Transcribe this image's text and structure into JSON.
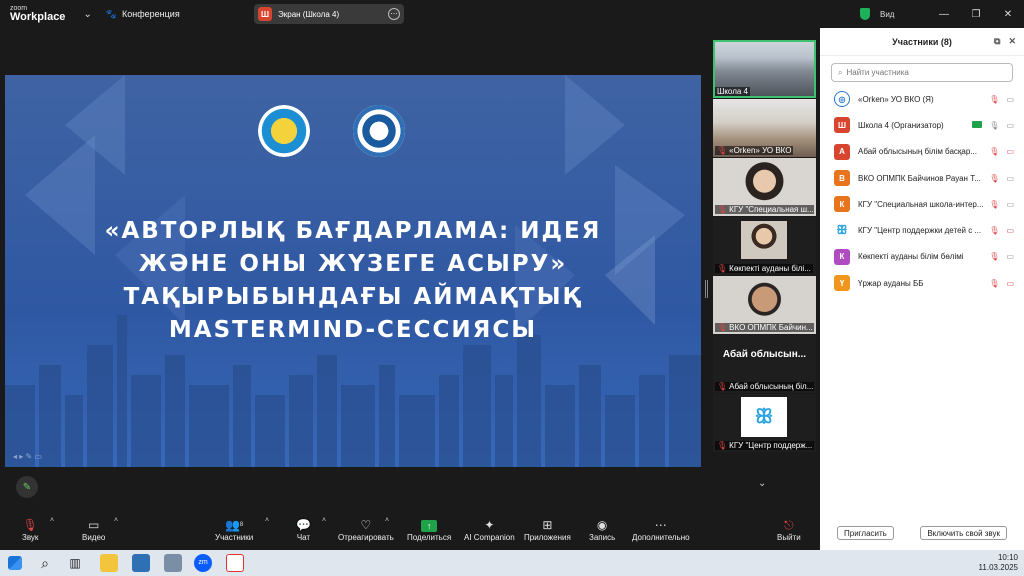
{
  "app": {
    "logo_line1": "zoom",
    "logo_line2": "Workplace",
    "meeting_label": "Конференция"
  },
  "share_pill": {
    "badge": "Ш",
    "label": "Экран (Школа 4)"
  },
  "view_label": "Вид",
  "slide": {
    "title_lines": [
      "«АВТОРЛЫҚ БАҒДАРЛАМА: ИДЕЯ",
      "ЖӘНЕ ОНЫ ЖҮЗЕГЕ АСЫРУ»",
      "ТАҚЫРЫБЫНДАҒЫ АЙМАҚТЫҚ",
      "MASTERMIND-СЕССИЯСЫ"
    ],
    "bg_color": "#3460aa"
  },
  "thumbnails": [
    {
      "name": "Школа 4",
      "muted": false,
      "active": true
    },
    {
      "name": "«Orken» УО ВКО",
      "muted": true
    },
    {
      "name": "КГУ \"Специальная ш...",
      "muted": true
    },
    {
      "name": "Көкпекті ауданы білі...",
      "muted": true
    },
    {
      "name": "ВКО ОПМПК Байчин...",
      "muted": true
    },
    {
      "name": "Абай облысының біл...",
      "muted": true,
      "big": "Абай облысын..."
    },
    {
      "name": "КГУ \"Центр поддерж...",
      "muted": true
    }
  ],
  "toolbar": {
    "audio": "Звук",
    "video": "Видео",
    "participants": "Участники",
    "participants_count": "8",
    "chat": "Чат",
    "react": "Отреагировать",
    "share": "Поделиться",
    "ai": "AI Companion",
    "apps": "Приложения",
    "record": "Запись",
    "more": "Дополнительно",
    "leave": "Выйти"
  },
  "panel": {
    "title": "Участники (8)",
    "search_placeholder": "Найти участника",
    "participants": [
      {
        "name": "«Orken» УО ВКО (Я)",
        "initial": "",
        "color": "#ffffff"
      },
      {
        "name": "Школа 4 (Организатор)",
        "initial": "Ш",
        "color": "#d8452f"
      },
      {
        "name": "Абай облысының білім басқар...",
        "initial": "А",
        "color": "#d8452f"
      },
      {
        "name": "ВКО ОПМПК Байчинов Рауан Т...",
        "initial": "В",
        "color": "#e8741e"
      },
      {
        "name": "КГУ \"Специальная школа-интер...",
        "initial": "К",
        "color": "#e8741e"
      },
      {
        "name": "КГУ \"Центр поддержки детей с ...",
        "initial": "",
        "color": "#ffffff"
      },
      {
        "name": "Көкпекті ауданы білім бөлімі",
        "initial": "К",
        "color": "#b04bc2"
      },
      {
        "name": "Үржар ауданы ББ",
        "initial": "Ү",
        "color": "#f0961f"
      }
    ],
    "invite_button": "Пригласить",
    "unmute_button": "Включить свой звук"
  },
  "taskbar": {
    "time": "10:10",
    "date": "11.03.2025"
  }
}
